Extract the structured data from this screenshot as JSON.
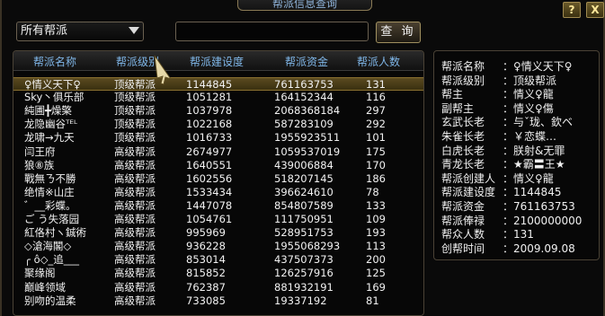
{
  "window": {
    "title": "帮派信息查询",
    "help_label": "?",
    "close_label": "X"
  },
  "filter": {
    "selected": "所有帮派",
    "search_value": "",
    "search_button": "查 询"
  },
  "table": {
    "headers": [
      "帮派名称",
      "帮派级别",
      "帮派建设度",
      "帮派资金",
      "帮派人数"
    ],
    "rows": [
      {
        "name": "♀情义天下♀",
        "level": "顶级帮派",
        "construction": "1144845",
        "funds": "761163753",
        "members": "131"
      },
      {
        "name": "Sky丶俱乐部",
        "level": "顶级帮派",
        "construction": "1051281",
        "funds": "164152344",
        "members": "116"
      },
      {
        "name": "純圃╋燥檠",
        "level": "顶级帮派",
        "construction": "1037978",
        "funds": "2068368184",
        "members": "297"
      },
      {
        "name": "龙隐幽谷ᵀᴱᴸ",
        "level": "顶级帮派",
        "construction": "1022168",
        "funds": "587283109",
        "members": "292"
      },
      {
        "name": "龙啸→九天",
        "level": "顶级帮派",
        "construction": "1016733",
        "funds": "1955923511",
        "members": "101"
      },
      {
        "name": "闫王府",
        "level": "高级帮派",
        "construction": "2674977",
        "funds": "1059537019",
        "members": "175"
      },
      {
        "name": "狼⑧族",
        "level": "高级帮派",
        "construction": "1640551",
        "funds": "439006884",
        "members": "170"
      },
      {
        "name": "戰無ㄋ不勝",
        "level": "高级帮派",
        "construction": "1602556",
        "funds": "518207145",
        "members": "186"
      },
      {
        "name": "绝情※山庄",
        "level": "高级帮派",
        "construction": "1533434",
        "funds": "396624610",
        "members": "78"
      },
      {
        "name": "゛__彩蝶。",
        "level": "高级帮派",
        "construction": "1447078",
        "funds": "854807589",
        "members": "133"
      },
      {
        "name": "ご う失落园",
        "level": "高级帮派",
        "construction": "1054761",
        "funds": "111750951",
        "members": "109"
      },
      {
        "name": "紅佫村ヽ鋮術",
        "level": "高级帮派",
        "construction": "995969",
        "funds": "528951753",
        "members": "193"
      },
      {
        "name": "◇滄海閣◇",
        "level": "高级帮派",
        "construction": "936228",
        "funds": "1955068293",
        "members": "113"
      },
      {
        "name": "╭ ô◇_追___",
        "level": "高级帮派",
        "construction": "853014",
        "funds": "437507373",
        "members": "200"
      },
      {
        "name": "聚缘阁",
        "level": "高级帮派",
        "construction": "815852",
        "funds": "126257916",
        "members": "125"
      },
      {
        "name": "巅峰领域",
        "level": "高级帮派",
        "construction": "762387",
        "funds": "881932191",
        "members": "169"
      },
      {
        "name": "别吻的温柔",
        "level": "高级帮派",
        "construction": "733085",
        "funds": "19337192",
        "members": "81"
      }
    ]
  },
  "info": {
    "rows": [
      {
        "label": "帮派名称",
        "value": "♀情义天下♀"
      },
      {
        "label": "帮派级别",
        "value": "顶级帮派"
      },
      {
        "label": "帮主",
        "value": "情义♀龍"
      },
      {
        "label": "副帮主",
        "value": "情义♀傷"
      },
      {
        "label": "玄武长老",
        "value": "与ˇ珑、欽ベ"
      },
      {
        "label": "朱雀长老",
        "value": "￥恋蝶…"
      },
      {
        "label": "白虎长老",
        "value": "朕射&无罪"
      },
      {
        "label": "青龙长老",
        "value": "★霸〓王★"
      },
      {
        "label": "帮派创建人",
        "value": "情义♀龍"
      },
      {
        "label": "帮派建设度",
        "value": "1144845"
      },
      {
        "label": "帮派资金",
        "value": "761163753"
      },
      {
        "label": "帮派俸禄",
        "value": "2100000000"
      },
      {
        "label": "帮众人数",
        "value": "131"
      },
      {
        "label": "创帮时间",
        "value": "2009.09.08"
      }
    ]
  },
  "colors": {
    "header_text": "#7fb6e8",
    "selected_row": "#5a4a20",
    "accent_gold": "#a08a50"
  },
  "icons": {
    "dropdown": "chevron-down-icon",
    "cursor": "pointer-cursor-icon"
  }
}
